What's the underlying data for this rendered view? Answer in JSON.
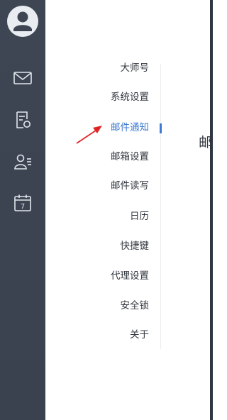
{
  "rail": {
    "icons": [
      "avatar-icon",
      "mail-icon",
      "compose-note-icon",
      "contacts-icon",
      "calendar-icon"
    ],
    "calendar_day": "7"
  },
  "settings_menu": {
    "items": [
      {
        "label": "大师号",
        "active": false
      },
      {
        "label": "系统设置",
        "active": false
      },
      {
        "label": "邮件通知",
        "active": true
      },
      {
        "label": "邮箱设置",
        "active": false
      },
      {
        "label": "邮件读写",
        "active": false
      },
      {
        "label": "日历",
        "active": false
      },
      {
        "label": "快捷键",
        "active": false
      },
      {
        "label": "代理设置",
        "active": false
      },
      {
        "label": "安全锁",
        "active": false
      },
      {
        "label": "关于",
        "active": false
      }
    ]
  },
  "content": {
    "title_fragment": "邮"
  },
  "colors": {
    "rail_bg": "#3e4654",
    "active_text": "#3e7ad1",
    "annotation_arrow": "#e02424"
  }
}
